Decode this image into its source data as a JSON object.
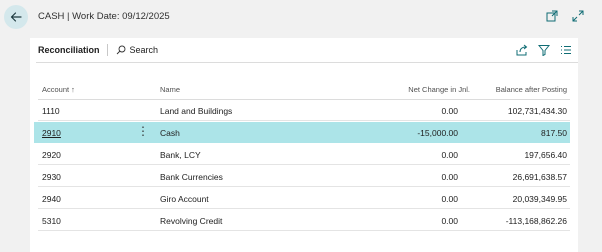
{
  "header": {
    "title": "CASH | Work Date: 09/12/2025"
  },
  "toolbar": {
    "tab_label": "Reconciliation",
    "search_label": "Search"
  },
  "table": {
    "columns": {
      "account": "Account ↑",
      "name": "Name",
      "net_change": "Net Change in Jnl.",
      "balance": "Balance after Posting"
    },
    "rows": [
      {
        "account": "1110",
        "name": "Land and Buildings",
        "net_change": "0.00",
        "balance": "102,731,434.30"
      },
      {
        "account": "2910",
        "name": "Cash",
        "net_change": "-15,000.00",
        "balance": "817.50"
      },
      {
        "account": "2920",
        "name": "Bank, LCY",
        "net_change": "0.00",
        "balance": "197,656.40"
      },
      {
        "account": "2930",
        "name": "Bank Currencies",
        "net_change": "0.00",
        "balance": "26,691,638.57"
      },
      {
        "account": "2940",
        "name": "Giro Account",
        "net_change": "0.00",
        "balance": "20,039,349.95"
      },
      {
        "account": "5310",
        "name": "Revolving Credit",
        "net_change": "0.00",
        "balance": "-113,168,862.26"
      }
    ],
    "selected_row": 1
  },
  "icons": {
    "back": "back-arrow-icon",
    "open_new": "open-in-new-window-icon",
    "expand": "expand-icon",
    "search": "search-icon",
    "share": "share-icon",
    "filter": "filter-icon",
    "list": "list-view-icon",
    "row_menu": "more-options-icon"
  },
  "colors": {
    "accent": "#0f6c74",
    "selected_row": "#ace4e8",
    "back_button_bg": "#d4e8ec"
  }
}
